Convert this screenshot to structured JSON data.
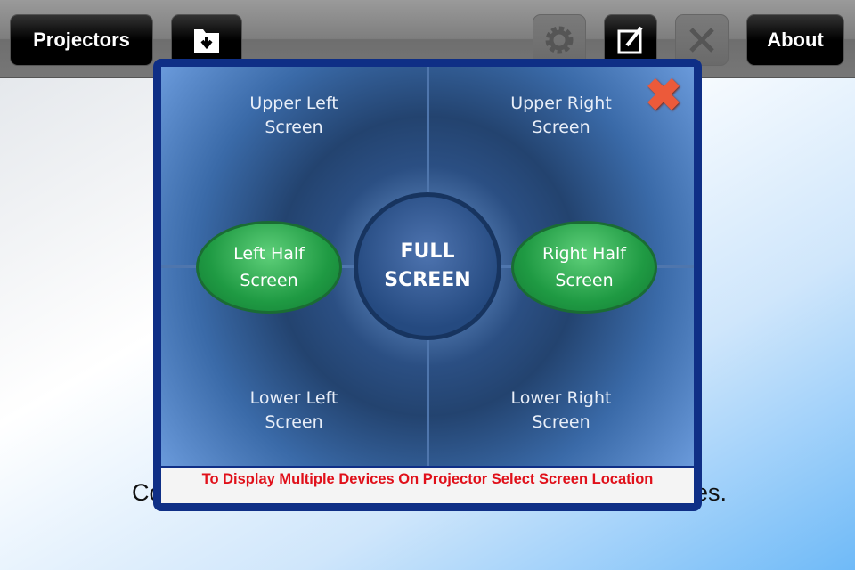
{
  "toolbar": {
    "projectors": "Projectors",
    "about": "About",
    "icons": [
      "folder-download-icon",
      "gear-icon",
      "edit-icon",
      "close-icon"
    ]
  },
  "background": {
    "text_left": "Co",
    "text_right": "es."
  },
  "modal": {
    "upper_left": [
      "Upper Left",
      "Screen"
    ],
    "upper_right": [
      "Upper Right",
      "Screen"
    ],
    "lower_left": [
      "Lower Left",
      "Screen"
    ],
    "lower_right": [
      "Lower Right",
      "Screen"
    ],
    "left_half": [
      "Left Half",
      "Screen"
    ],
    "right_half": [
      "Right Half",
      "Screen"
    ],
    "full": [
      "FULL",
      "SCREEN"
    ],
    "footer": "To Display Multiple Devices On Projector Select Screen Location",
    "colors": {
      "frame": "#0f2f86",
      "oval": "#1f9a43",
      "footer_text": "#e0101a"
    }
  }
}
